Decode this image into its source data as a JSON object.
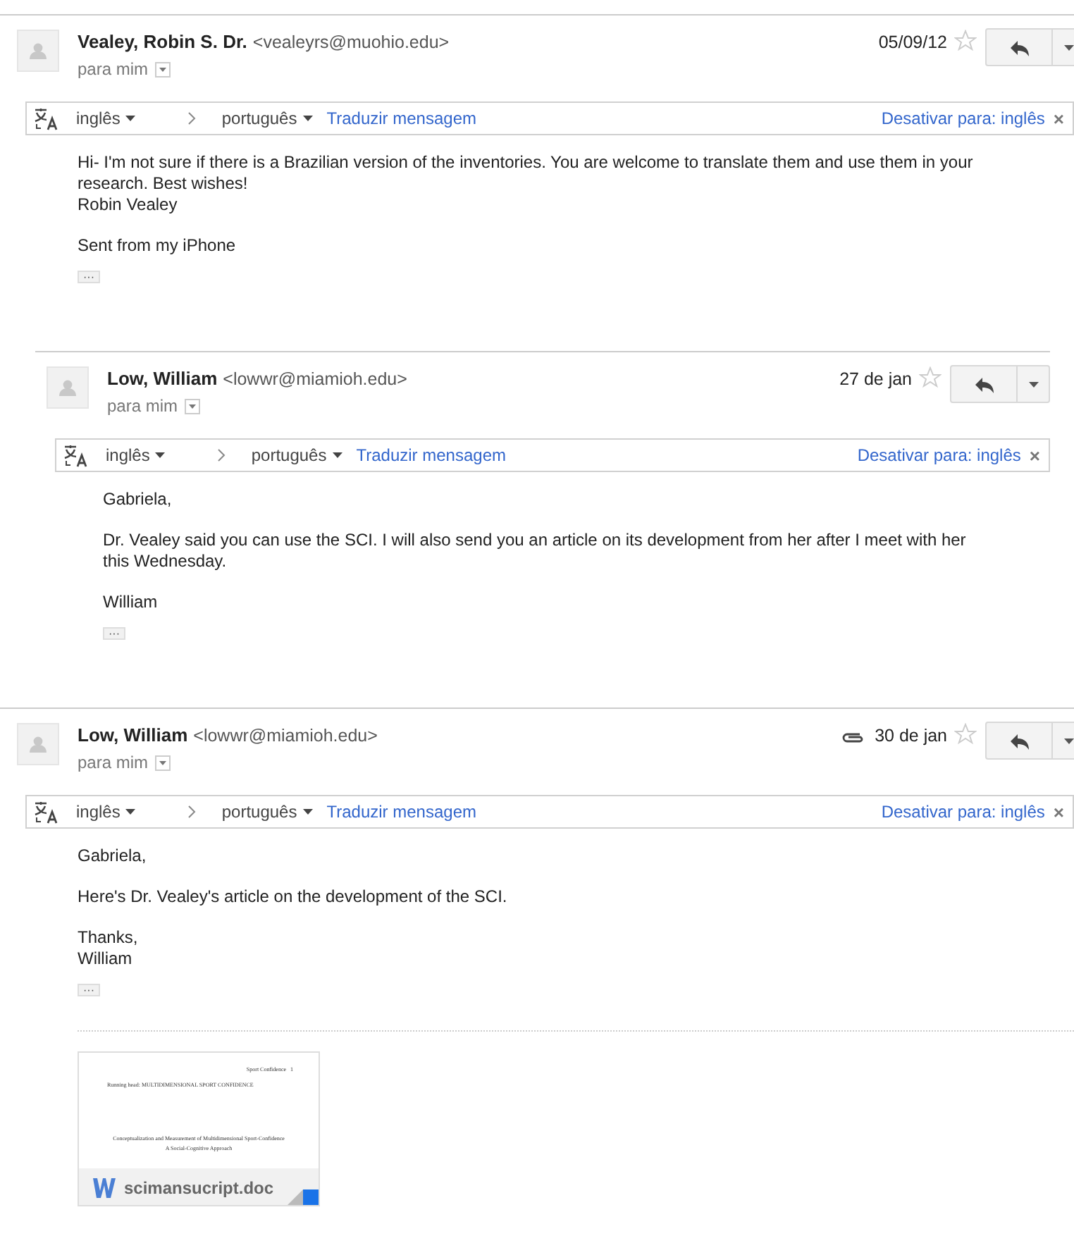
{
  "messages": [
    {
      "indented": false,
      "sender": "Vealey, Robin S. Dr.",
      "email": "<vealeyrs@muohio.edu>",
      "date": "05/09/12",
      "has_attachment": false,
      "starred": false,
      "recipient": "para mim",
      "translate": {
        "from": "inglês",
        "to": "português",
        "action": "Traduzir mensagem",
        "disable": "Desativar para: inglês",
        "close": "×"
      },
      "body": [
        "Hi- I'm not sure if there is a Brazilian version of the inventories. You are welcome to translate them and use them in your research. Best wishes!\nRobin Vealey",
        "Sent from my iPhone"
      ],
      "trimmed": "···"
    },
    {
      "indented": true,
      "sender": "Low, William",
      "email": "<lowwr@miamioh.edu>",
      "date": "27 de jan",
      "has_attachment": false,
      "starred": false,
      "recipient": "para mim",
      "translate": {
        "from": "inglês",
        "to": "português",
        "action": "Traduzir mensagem",
        "disable": "Desativar para: inglês",
        "close": "×"
      },
      "body": [
        "Gabriela,",
        "Dr. Vealey said you can use the SCI. I will also send you an article on its development from her after I meet with her this Wednesday.",
        "William"
      ],
      "trimmed": "···"
    },
    {
      "indented": false,
      "sender": "Low, William",
      "email": "<lowwr@miamioh.edu>",
      "date": "30 de jan",
      "has_attachment": true,
      "starred": false,
      "recipient": "para mim",
      "translate": {
        "from": "inglês",
        "to": "português",
        "action": "Traduzir mensagem",
        "disable": "Desativar para: inglês",
        "close": "×"
      },
      "body": [
        "Gabriela,",
        "Here's Dr. Vealey's article on the development of the SCI.",
        "Thanks,\nWilliam"
      ],
      "trimmed": "···",
      "attachment": {
        "file_name": "scimansucript.doc",
        "preview": {
          "page_header": "Sport Confidence   1",
          "running_head": "Running head: MULTIDIMENSIONAL SPORT CONFIDENCE",
          "title": "Conceptualization and Measurement of Multidimensional Sport-Confidence",
          "subtitle": "A Social-Cognitive Approach"
        }
      }
    }
  ]
}
